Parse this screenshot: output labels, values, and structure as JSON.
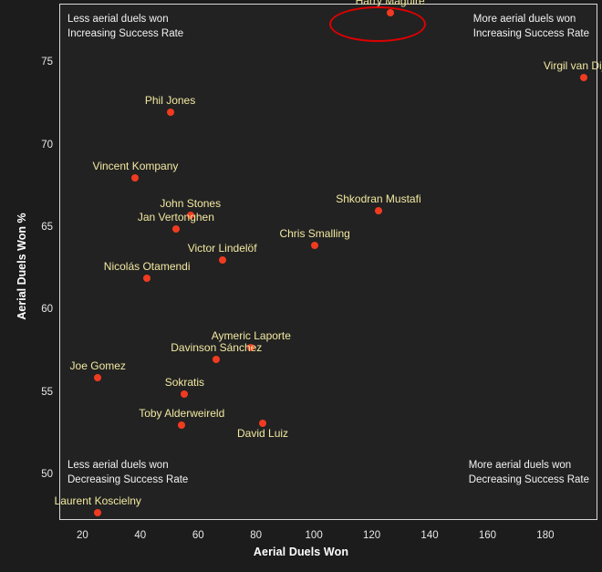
{
  "chart_data": {
    "type": "scatter",
    "title": "",
    "xlabel": "Aerial Duels Won",
    "ylabel": "Aerial Duels Won %",
    "xlim": [
      12,
      198
    ],
    "ylim": [
      47.3,
      78.6
    ],
    "xticks": [
      20,
      40,
      60,
      80,
      100,
      120,
      140,
      160,
      180
    ],
    "yticks": [
      50,
      55,
      60,
      65,
      70,
      75
    ],
    "grid": false,
    "legend": null,
    "marker_color": "#f03b20",
    "label_color": "#f2e9a0",
    "background_color": "#222222",
    "highlight": {
      "player": "Harry Maguire",
      "shape": "ellipse",
      "color": "#e00000"
    },
    "points": [
      {
        "label": "Harry Maguire",
        "x": 126,
        "y": 78.1,
        "label_dx": 0,
        "label_dy": -6
      },
      {
        "label": "Virgil van Dijk",
        "x": 193,
        "y": 74.2,
        "label_dx": -8,
        "label_dy": -6
      },
      {
        "label": "Phil Jones",
        "x": 50,
        "y": 72.1,
        "label_dx": 0,
        "label_dy": -6
      },
      {
        "label": "Vincent Kompany",
        "x": 38,
        "y": 68.1,
        "label_dx": 0,
        "label_dy": -6
      },
      {
        "label": "John Stones",
        "x": 57,
        "y": 65.8,
        "label_dx": 0,
        "label_dy": -6
      },
      {
        "label": "Jan Vertonghen",
        "x": 52,
        "y": 65.0,
        "label_dx": 0,
        "label_dy": -6
      },
      {
        "label": "Shkodran Mustafi",
        "x": 122,
        "y": 66.1,
        "label_dx": 0,
        "label_dy": -6
      },
      {
        "label": "Chris Smalling",
        "x": 100,
        "y": 64.0,
        "label_dx": 0,
        "label_dy": -6
      },
      {
        "label": "Victor Lindelöf",
        "x": 68,
        "y": 63.1,
        "label_dx": 0,
        "label_dy": -6
      },
      {
        "label": "Nicolás Otamendi",
        "x": 42,
        "y": 62.0,
        "label_dx": 0,
        "label_dy": -6
      },
      {
        "label": "Aymeric Laporte",
        "x": 78,
        "y": 57.8,
        "label_dx": 0,
        "label_dy": -6
      },
      {
        "label": "Davinson Sánchez",
        "x": 66,
        "y": 57.1,
        "label_dx": 0,
        "label_dy": -6
      },
      {
        "label": "Joe Gomez",
        "x": 25,
        "y": 56.0,
        "label_dx": 0,
        "label_dy": -6
      },
      {
        "label": "Sokratis",
        "x": 55,
        "y": 55.0,
        "label_dx": 0,
        "label_dy": -6
      },
      {
        "label": "Toby Alderweireld",
        "x": 54,
        "y": 53.1,
        "label_dx": 0,
        "label_dy": -6
      },
      {
        "label": "David Luiz",
        "x": 82,
        "y": 53.2,
        "label_dx": 0,
        "label_dy": 18
      },
      {
        "label": "Laurent Koscielny",
        "x": 25,
        "y": 47.8,
        "label_dx": 0,
        "label_dy": -6
      }
    ],
    "annotations": [
      {
        "id": "top-left",
        "lines": [
          "Less aerial duels won",
          "Increasing Success Rate"
        ]
      },
      {
        "id": "top-right",
        "lines": [
          "More aerial duels won",
          "Increasing Success Rate"
        ]
      },
      {
        "id": "bottom-left",
        "lines": [
          "Less aerial duels won",
          "Decreasing Success Rate"
        ]
      },
      {
        "id": "bottom-right",
        "lines": [
          "More aerial duels won",
          "Decreasing Success Rate"
        ]
      }
    ]
  }
}
